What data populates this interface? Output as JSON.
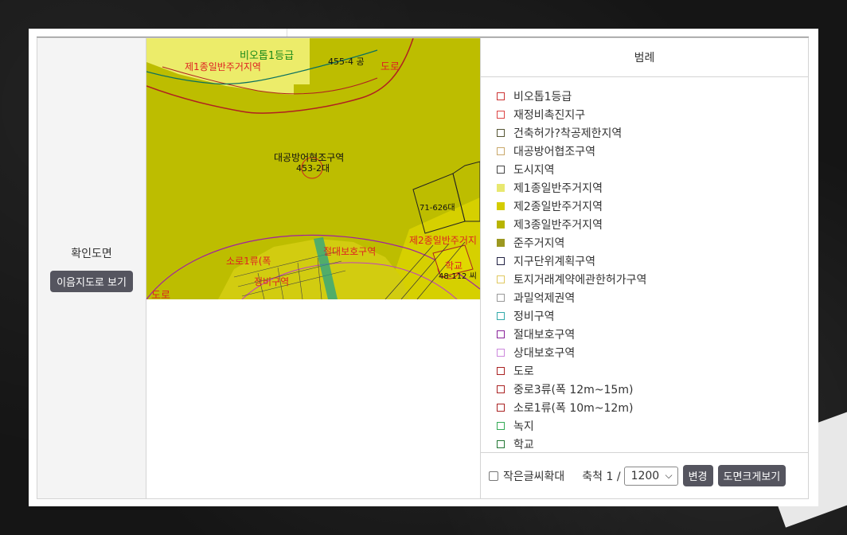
{
  "sidebar": {
    "title": "확인도면",
    "view_button": "이음지도로 보기"
  },
  "map": {
    "labels": {
      "bioto": "비오톱1등급",
      "jeil": "제1종일반주거지역",
      "parcel_455": "455-4 공",
      "road_top": "도로",
      "daegong": "대공방어협조구역",
      "parcel_453": "453-2대",
      "parcel_71": "71-626대",
      "jeoldae": "절대보호구역",
      "jei2": "제2종일반주거지",
      "school": "학교",
      "parcel_48": "48-112 씨",
      "soro": "소로1류(폭",
      "jeongbi": "정비구역",
      "road_bottom": "도로"
    }
  },
  "legend": {
    "title": "범례",
    "items": [
      {
        "label": "비오톱1등급",
        "color": "#cc3333",
        "fill": "none"
      },
      {
        "label": "재정비촉진지구",
        "color": "#dd4444",
        "fill": "none"
      },
      {
        "label": "건축허가?착공제한지역",
        "color": "#555533",
        "fill": "none"
      },
      {
        "label": "대공방어협조구역",
        "color": "#c9a86a",
        "fill": "none"
      },
      {
        "label": "도시지역",
        "color": "#444444",
        "fill": "none"
      },
      {
        "label": "제1종일반주거지역",
        "color": "#e8e870",
        "fill": "#e8e870"
      },
      {
        "label": "제2종일반주거지역",
        "color": "#d4cc00",
        "fill": "#d4cc00"
      },
      {
        "label": "제3종일반주거지역",
        "color": "#b8b400",
        "fill": "#b8b400"
      },
      {
        "label": "준주거지역",
        "color": "#9c9820",
        "fill": "#9c9820"
      },
      {
        "label": "지구단위계획구역",
        "color": "#222244",
        "fill": "none"
      },
      {
        "label": "토지거래계약에관한허가구역",
        "color": "#e0c860",
        "fill": "none"
      },
      {
        "label": "과밀억제권역",
        "color": "#999999",
        "fill": "none"
      },
      {
        "label": "정비구역",
        "color": "#33aaaa",
        "fill": "none"
      },
      {
        "label": "절대보호구역",
        "color": "#882299",
        "fill": "none"
      },
      {
        "label": "상대보호구역",
        "color": "#cc88dd",
        "fill": "none"
      },
      {
        "label": "도로",
        "color": "#aa2222",
        "fill": "none"
      },
      {
        "label": "중로3류(폭 12m~15m)",
        "color": "#aa2222",
        "fill": "none"
      },
      {
        "label": "소로1류(폭 10m~12m)",
        "color": "#aa2222",
        "fill": "none"
      },
      {
        "label": "녹지",
        "color": "#33aa55",
        "fill": "none"
      },
      {
        "label": "학교",
        "color": "#227733",
        "fill": "none"
      }
    ]
  },
  "footer": {
    "enlarge_label": "작은글씨확대",
    "scale_label": "축척 1 /",
    "scale_value": "1200",
    "change_button": "변경",
    "enlarge_map_button": "도면크게보기"
  }
}
